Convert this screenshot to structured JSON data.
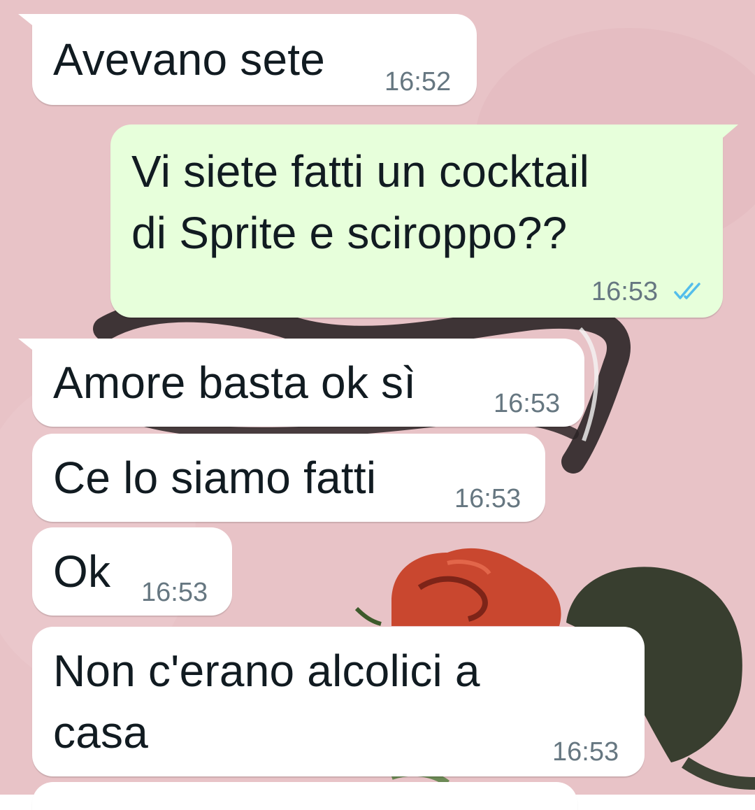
{
  "messages": [
    {
      "direction": "incoming",
      "text": "Avevano sete",
      "time": "16:52"
    },
    {
      "direction": "outgoing",
      "lines": [
        "Vi siete fatti un cocktail",
        "di Sprite e sciroppo??"
      ],
      "time": "16:53",
      "status": "read",
      "status_icon": "double-check-icon",
      "status_color": "#53bdeb"
    },
    {
      "direction": "incoming",
      "text": "Amore basta ok sì",
      "time": "16:53"
    },
    {
      "direction": "incoming",
      "text": "Ce lo siamo fatti",
      "time": "16:53"
    },
    {
      "direction": "incoming",
      "text": "Ok",
      "time": "16:53"
    },
    {
      "direction": "incoming",
      "lines": [
        "Non c'erano alcolici a",
        "casa"
      ],
      "time": "16:53"
    }
  ],
  "colors": {
    "incoming_bubble": "#ffffff",
    "outgoing_bubble": "#e7ffdb",
    "wallpaper": "#e8c3c7",
    "text": "#111b21",
    "timestamp": "#667781"
  }
}
